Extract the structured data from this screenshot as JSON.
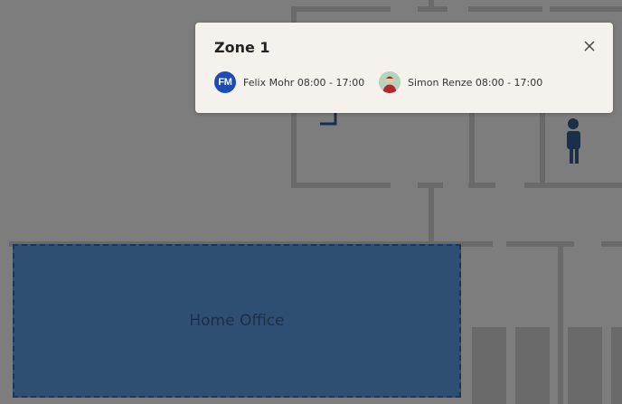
{
  "map": {
    "wall_color": "#6a6a6a",
    "background_color": "#7d7d7d",
    "home_office_zone": {
      "label": "Home Office",
      "fill_color": "#2f4e74"
    },
    "person_marker_color": "#1c2f4a"
  },
  "popup": {
    "title": "Zone 1",
    "close_icon": "close-icon",
    "people": [
      {
        "avatar_initials": "FM",
        "avatar_color": "#1f49b3",
        "text": "Felix Mohr 08:00 - 17:00"
      },
      {
        "avatar_type": "photo",
        "text": "Simon Renze 08:00 - 17:00"
      }
    ]
  }
}
